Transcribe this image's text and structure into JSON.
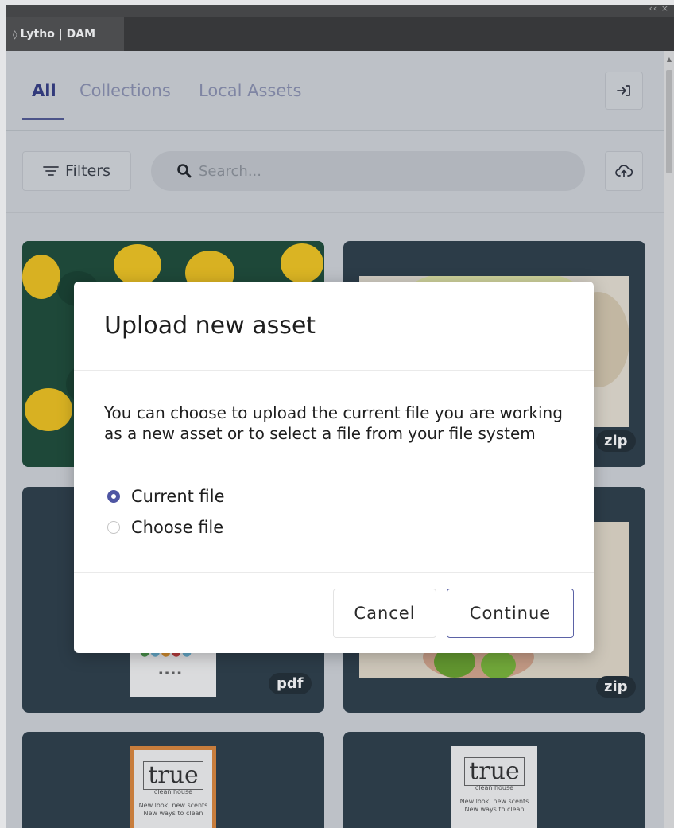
{
  "panel": {
    "title": "Lytho | DAM",
    "collapse_label": "‹‹",
    "close_label": "×"
  },
  "nav": {
    "tabs": [
      {
        "label": "All",
        "active": true
      },
      {
        "label": "Collections",
        "active": false
      },
      {
        "label": "Local Assets",
        "active": false
      }
    ],
    "exit_icon": "log-in-icon"
  },
  "toolbar": {
    "filters_label": "Filters",
    "search_placeholder": "Search...",
    "upload_icon": "cloud-upload-icon"
  },
  "assets": [
    {
      "type_badge": "",
      "thumbnail": "lemons-photo"
    },
    {
      "type_badge": "zip",
      "thumbnail": "cut-fruit-photo"
    },
    {
      "type_badge": "pdf",
      "thumbnail": "document-poster"
    },
    {
      "type_badge": "zip",
      "thumbnail": "limes-photo"
    },
    {
      "type_badge": "",
      "thumbnail": "true-clean-house-poster-orange"
    },
    {
      "type_badge": "",
      "thumbnail": "true-clean-house-poster-white"
    }
  ],
  "poster": {
    "brand": "true",
    "sub": "clean house",
    "line1": "New look, new scents",
    "line2": "New ways to clean"
  },
  "dialog": {
    "title": "Upload new asset",
    "body": "You can choose to upload the current file you are working as a new asset or to select a file from your file system",
    "options": [
      {
        "label": "Current file",
        "selected": true
      },
      {
        "label": "Choose file",
        "selected": false
      }
    ],
    "cancel_label": "Cancel",
    "continue_label": "Continue"
  },
  "colors": {
    "accent": "#4e55a3",
    "panel_bg": "#d3d7db",
    "card_bg": "#2e3f4b"
  }
}
